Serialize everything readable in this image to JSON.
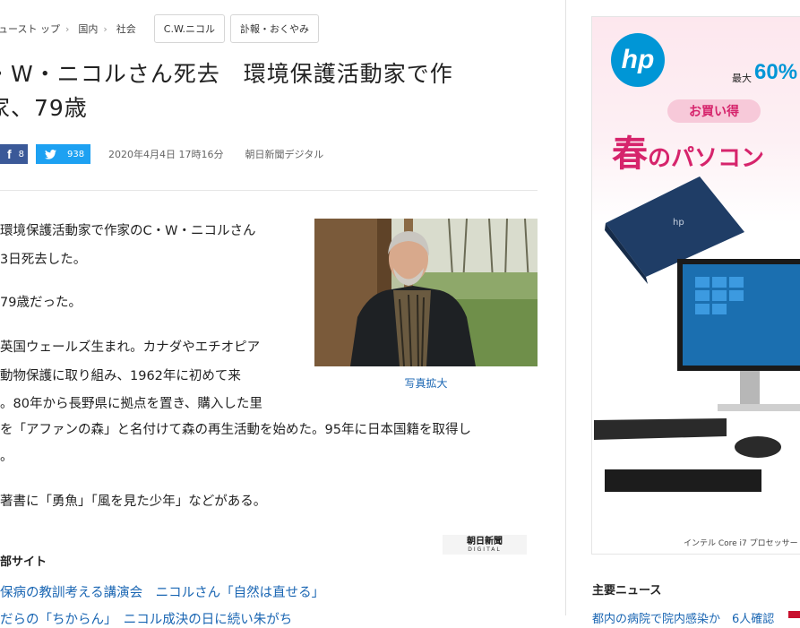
{
  "breadcrumb": {
    "items": [
      "ュースト ップ",
      "国内",
      "社会"
    ],
    "tags": [
      "C.W.ニコル",
      "訃報・おくやみ"
    ]
  },
  "article": {
    "headline_line1": "・W・ニコルさん死去　環境保護活動家で作",
    "headline_line2": "家、79歳",
    "facebook_count": "8",
    "twitter_count": "938",
    "date": "2020年4月4日 17時16分",
    "source": "朝日新聞デジタル",
    "paragraphs": [
      "環境保護活動家で作家のC・W・ニコルさん",
      "3日死去した。",
      "79歳だった。",
      "英国ウェールズ生まれ。カナダやエチオピア",
      "動物保護に取り組み、1962年に初めて来",
      "。80年から長野県に拠点を置き、購入した里",
      "を「アファンの森」と名付けて森の再生活動を始めた。95年に日本国籍を取得し",
      "。",
      "著書に「勇魚」「風を見た少年」などがある。"
    ],
    "photo_caption": "写真拡大",
    "logo_line1": "朝日新聞",
    "logo_line2": "DIGITAL"
  },
  "related": {
    "heading": "部サイト",
    "links": [
      "保病の教訓考える講演会　ニコルさん「自然は直せる」",
      "だらの「ちからん」　ニコル成決の日に続い朱がち"
    ]
  },
  "ad": {
    "brand": "hp",
    "discount_label": "最大",
    "discount": "60%",
    "pill": "お買い得",
    "headline_big": "春",
    "headline_small": "のパソコン",
    "footnote": "インテル Core i7 プロセッサー",
    "colors": {
      "hp_blue": "#0096d6",
      "pink": "#d6246c"
    }
  },
  "sidebar": {
    "main_news_heading": "主要ニュース",
    "main_news_first": "都内の病院で院内感染か　6人確認"
  },
  "icons": {
    "facebook": "facebook-icon",
    "twitter": "twitter-icon",
    "chevron": "chevron-right-icon"
  }
}
